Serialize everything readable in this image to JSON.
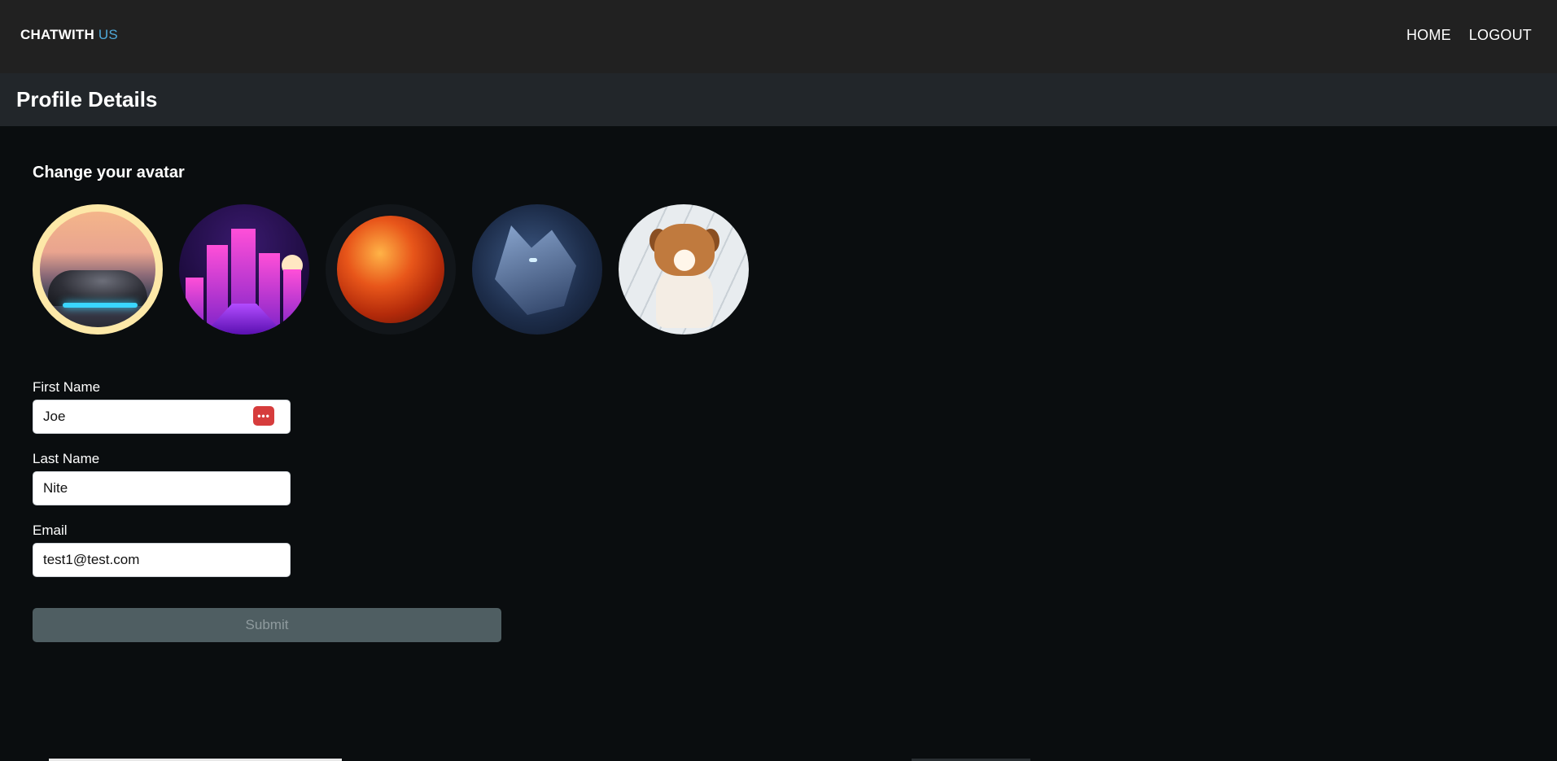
{
  "navbar": {
    "brand_primary": "CHATWITH",
    "brand_accent": "US",
    "links": [
      {
        "label": "HOME"
      },
      {
        "label": "LOGOUT"
      }
    ]
  },
  "header": {
    "title": "Profile Details"
  },
  "avatar_section": {
    "title": "Change your avatar",
    "avatars": [
      {
        "name": "car",
        "selected": true
      },
      {
        "name": "neon-city",
        "selected": false
      },
      {
        "name": "planet",
        "selected": false
      },
      {
        "name": "wolf",
        "selected": false
      },
      {
        "name": "puppy",
        "selected": false
      }
    ]
  },
  "form": {
    "first_name": {
      "label": "First Name",
      "value": "Joe"
    },
    "last_name": {
      "label": "Last Name",
      "value": "Nite"
    },
    "email": {
      "label": "Email",
      "value": "test1@test.com"
    },
    "submit_label": "Submit"
  },
  "colors": {
    "background": "#0a0d0f",
    "navbar": "#212121",
    "subheader": "#22262a",
    "brand_accent": "#4fa8d8",
    "selected_avatar_ring": "#fde8a8",
    "submit_bg": "#4f5e62",
    "password_manager_icon": "#d63c3c"
  }
}
